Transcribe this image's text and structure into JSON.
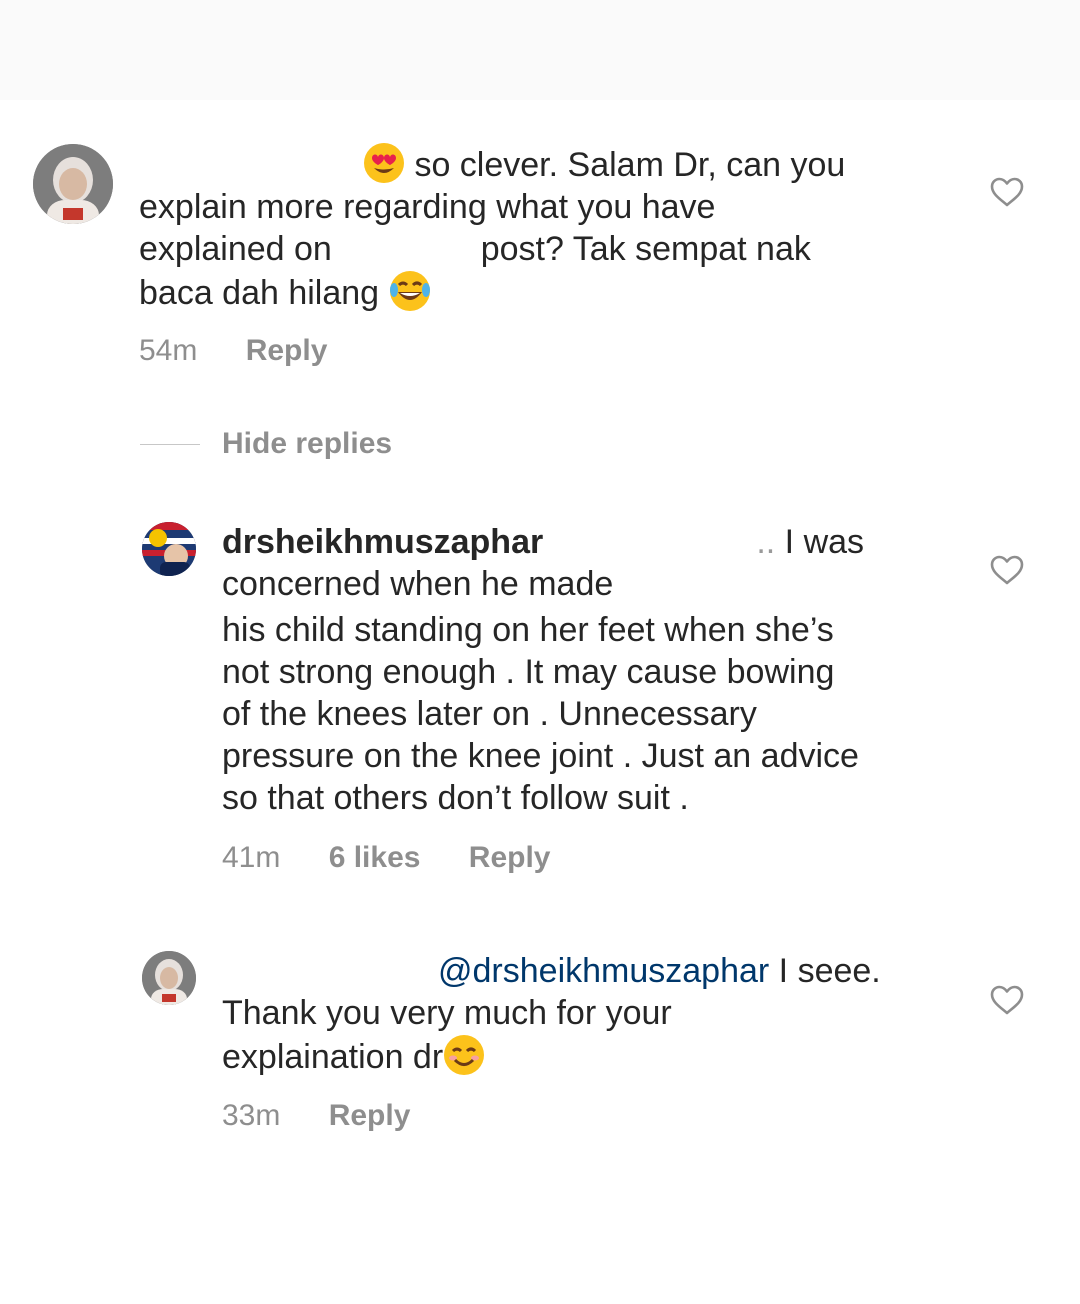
{
  "comments": [
    {
      "text_line1": "so clever. Salam Dr, can you",
      "text_line2": "explain more regarding what you have",
      "text_line3_a": "explained on",
      "text_line3_b": "post? Tak sempat nak",
      "text_line4": "baca dah hilang",
      "emoji_1": "heart-eyes-emoji",
      "emoji_2": "tears-of-joy-emoji",
      "time": "54m",
      "reply_label": "Reply"
    },
    {
      "username": "drsheikhmuszaphar",
      "text_line1_end": "I was",
      "text_line2": "concerned when he made",
      "text_line3": "his child standing on her feet when she’s",
      "text_line4": "not strong enough . It may cause bowing",
      "text_line5": "of the knees later on . Unnecessary",
      "text_line6": "pressure on the knee joint . Just an advice",
      "text_line7": "so that others don’t follow suit .",
      "time": "41m",
      "likes": "6 likes",
      "reply_label": "Reply"
    },
    {
      "mention": "@drsheikhmuszaphar",
      "text_line1_end": "I seee.",
      "text_line2": "Thank you very much for your",
      "text_line3": "explaination dr",
      "emoji": "smiling-emoji",
      "time": "33m",
      "reply_label": "Reply"
    }
  ],
  "hide_replies_label": "Hide replies",
  "colors": {
    "text": "#262626",
    "meta": "#8e8e8e",
    "mention": "#00376b",
    "divider": "#c7c7c7"
  }
}
